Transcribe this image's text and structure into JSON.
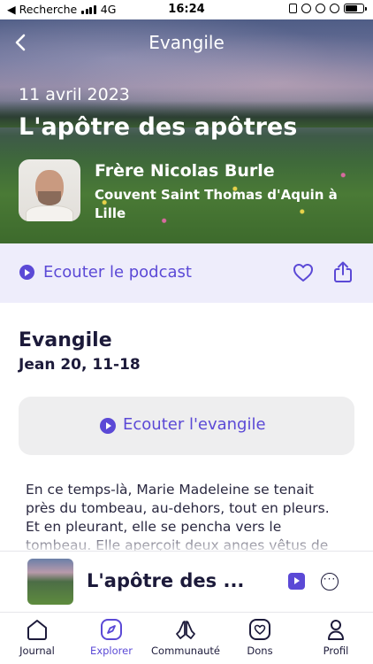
{
  "status_bar": {
    "carrier": "◀ Recherche",
    "network": "4G",
    "time": "16:24"
  },
  "header": {
    "title": "Evangile",
    "back_icon": "chevron-left-icon"
  },
  "hero": {
    "date": "11 avril 2023",
    "heading": "L'apôtre des apôtres",
    "author_name": "Frère Nicolas Burle",
    "author_place": "Couvent Saint Thomas d'Aquin à Lille"
  },
  "podcast": {
    "label": "Ecouter le podcast",
    "icons": [
      "play-circle-icon",
      "heart-icon",
      "share-icon"
    ]
  },
  "gospel": {
    "title": "Evangile",
    "reference": "Jean 20, 11-18",
    "listen_label": "Ecouter l'evangile",
    "text": "En ce temps-là, Marie Madeleine se tenait près du tombeau, au-dehors, tout en pleurs. Et en pleurant, elle se pencha vers le tombeau. Elle aperçoit deux anges vêtus de blanc, assis l'un à"
  },
  "mini_player": {
    "title": "L'apôtre des ...",
    "more_symbol": "···"
  },
  "tabs": [
    {
      "label": "Journal",
      "icon": "house-icon",
      "active": false
    },
    {
      "label": "Explorer",
      "icon": "compass-icon",
      "active": true
    },
    {
      "label": "Communauté",
      "icon": "praying-hands-icon",
      "active": false
    },
    {
      "label": "Dons",
      "icon": "heart-box-icon",
      "active": false
    },
    {
      "label": "Profil",
      "icon": "person-icon",
      "active": false
    }
  ],
  "colors": {
    "accent": "#5b49d6",
    "text_dark": "#1c1a3a",
    "podcast_bg": "#eeedfb",
    "button_bg": "#eeeeef"
  }
}
